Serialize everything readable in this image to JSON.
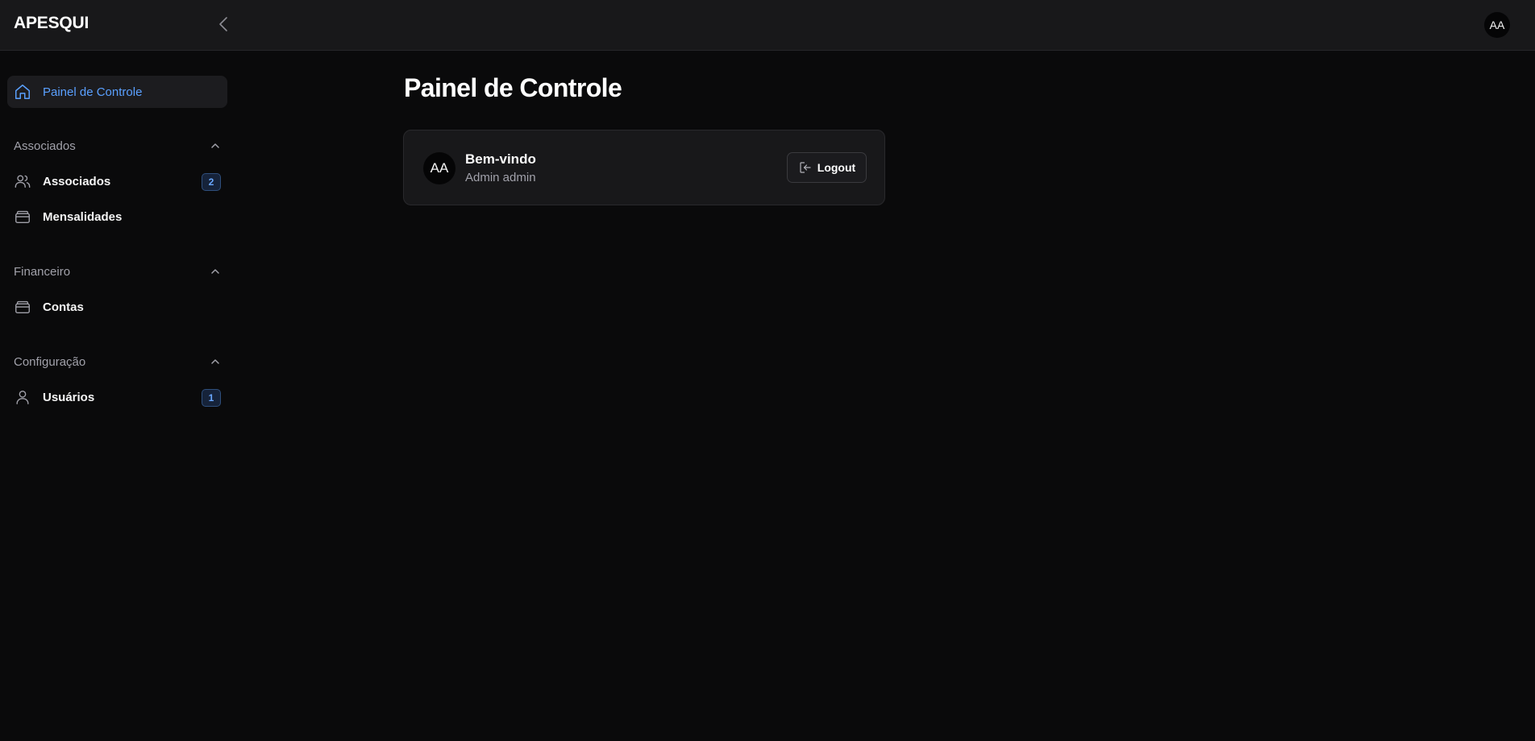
{
  "app": {
    "brand": "APESQUI",
    "user_initials": "AA"
  },
  "sidebar": {
    "home": {
      "label": "Painel de Controle",
      "icon": "home-icon"
    },
    "sections": [
      {
        "title": "Associados",
        "items": [
          {
            "label": "Associados",
            "icon": "users-icon",
            "badge": "2"
          },
          {
            "label": "Mensalidades",
            "icon": "wallet-icon"
          }
        ]
      },
      {
        "title": "Financeiro",
        "items": [
          {
            "label": "Contas",
            "icon": "wallet-icon"
          }
        ]
      },
      {
        "title": "Configuração",
        "items": [
          {
            "label": "Usuários",
            "icon": "user-icon",
            "badge": "1"
          }
        ]
      }
    ]
  },
  "main": {
    "title": "Painel de Controle",
    "welcome_card": {
      "avatar_initials": "AA",
      "greeting": "Bem-vindo",
      "user_name": "Admin admin",
      "logout_label": "Logout"
    }
  },
  "colors": {
    "accent": "#5aa0ff",
    "background": "#0a0a0b",
    "topbar": "#18181a"
  }
}
